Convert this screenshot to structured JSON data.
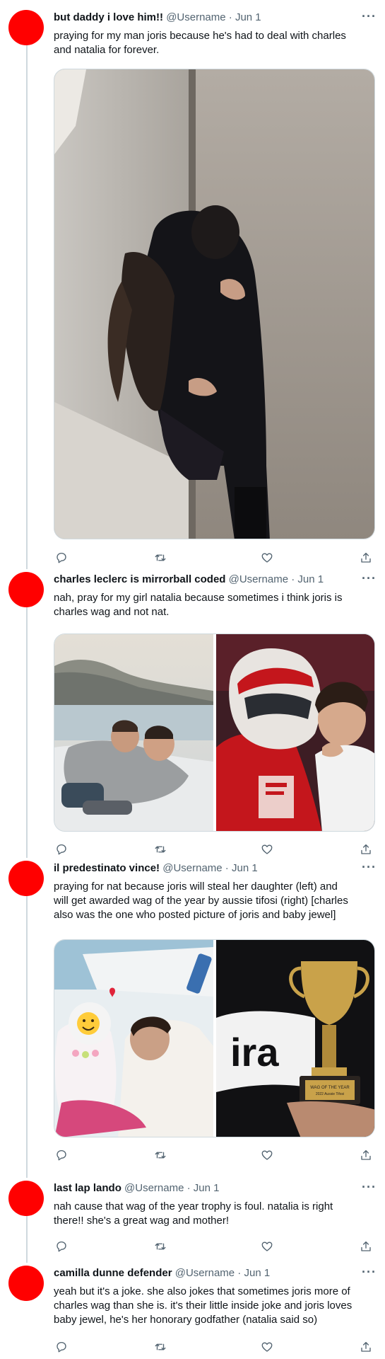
{
  "tweets": [
    {
      "name": "but daddy i love him!!",
      "handle": "@Username",
      "date": "Jun 1",
      "more": "···",
      "text_lines": [
        "praying for my man joris because he's had to deal with charles",
        "and natalia for forever."
      ]
    },
    {
      "name": "charles leclerc is mirrorball coded",
      "handle": "@Username",
      "date": "Jun 1",
      "more": "···",
      "text_lines": [
        "nah, pray for my girl natalia because sometimes i think joris is",
        "charles wag and not nat."
      ]
    },
    {
      "name": "il predestinato vince!",
      "handle": "@Username",
      "date": "Jun 1",
      "more": "···",
      "text_lines": [
        "praying for nat because joris will steal her daughter (left) and",
        "will get awarded wag of the year by aussie tifosi (right) [charles",
        "also was the one who posted picture of joris and baby jewel]"
      ],
      "photo_texts": {
        "jersey": "ira",
        "plaque_title": "WAG OF THE YEAR",
        "plaque_sub": "2022 Aussie Tifosi"
      }
    },
    {
      "name": "last lap lando",
      "handle": "@Username",
      "date": "Jun 1",
      "more": "···",
      "text_lines": [
        "nah cause that wag of the year trophy is foul. natalia is right",
        "there!! she's a great wag and mother!"
      ]
    },
    {
      "name": "camilla dunne defender",
      "handle": "@Username",
      "date": "Jun 1",
      "more": "···",
      "text_lines": [
        "yeah but it's a joke. she also jokes that sometimes joris more of",
        "charles wag than she is. it's their little inside joke and joris loves",
        "baby jewel, he's her honorary godfather (natalia said so)"
      ]
    }
  ],
  "colors": {
    "avatar": "#ff0000",
    "secondary_text": "#536471",
    "thread_line": "#cfd9de"
  },
  "icons": [
    "reply-icon",
    "retweet-icon",
    "like-icon",
    "share-icon",
    "more-icon"
  ]
}
